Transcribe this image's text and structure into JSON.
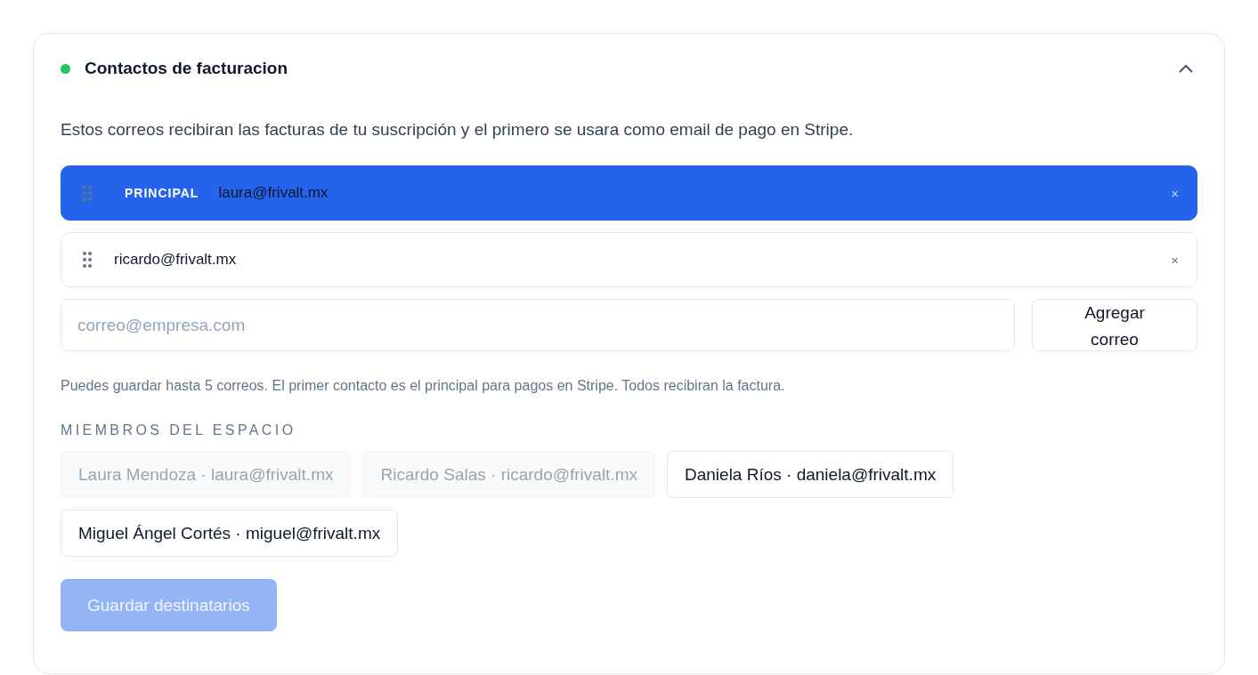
{
  "section": {
    "title": "Contactos de facturacion",
    "color": "#22c55e",
    "expanded": true
  },
  "description": "Estos correos recibiran las facturas de tu suscripción y el primero se usara como email de pago en Stripe.",
  "emails": [
    {
      "email": "laura@frivalt.mx",
      "primary": true,
      "badge": "PRINCIPAL",
      "remove": "×"
    },
    {
      "email": "ricardo@frivalt.mx",
      "primary": false,
      "remove": "×"
    }
  ],
  "new_email": {
    "placeholder": "correo@empresa.com"
  },
  "add_button": "Agregar correo",
  "hint": "Puedes guardar hasta 5 correos. El primer contacto es el principal para pagos en Stripe. Todos recibiran la factura.",
  "members_label": "MIEMBROS DEL ESPACIO",
  "members": [
    {
      "label": "Laura Mendoza · laura@frivalt.mx",
      "disabled": true
    },
    {
      "label": "Ricardo Salas · ricardo@frivalt.mx",
      "disabled": true
    },
    {
      "label": "Daniela Ríos · daniela@frivalt.mx",
      "disabled": false
    },
    {
      "label": "Miguel Ángel Cortés · miguel@frivalt.mx",
      "disabled": false
    }
  ],
  "save_button": {
    "label": "Guardar destinatarios",
    "disabled": true
  }
}
